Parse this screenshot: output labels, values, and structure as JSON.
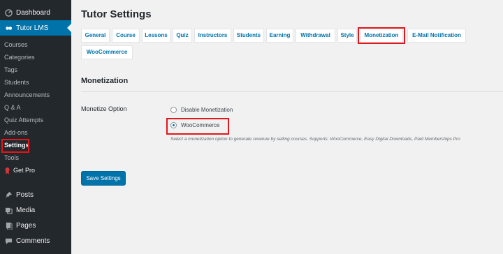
{
  "sidebar": {
    "dashboard": "Dashboard",
    "tutor": "Tutor LMS",
    "submenu": [
      "Courses",
      "Categories",
      "Tags",
      "Students",
      "Announcements",
      "Q & A",
      "Quiz Attempts",
      "Add-ons",
      "Settings",
      "Tools",
      "Get Pro"
    ],
    "posts": "Posts",
    "media": "Media",
    "pages": "Pages",
    "comments": "Comments"
  },
  "page": {
    "title": "Tutor Settings"
  },
  "tabs": [
    "General",
    "Course",
    "Lessons",
    "Quiz",
    "Instructors",
    "Students",
    "Earning",
    "Withdrawal",
    "Style",
    "Monetization",
    "E-Mail Notification",
    "WooCommerce"
  ],
  "section": {
    "title": "Monetization",
    "option_label": "Monetize Option",
    "options": [
      "Disable Monetization",
      "WooCommerce"
    ],
    "selected": "WooCommerce",
    "description": "Select a monetization option to generate revenue by selling courses. Supports: WooCommerce, Easy Digital Downloads, Paid Memberships Pro"
  },
  "save_label": "Save Settings",
  "colors": {
    "sidebar": "#23282d",
    "accent": "#0073aa",
    "highlight": "#e3161c"
  }
}
